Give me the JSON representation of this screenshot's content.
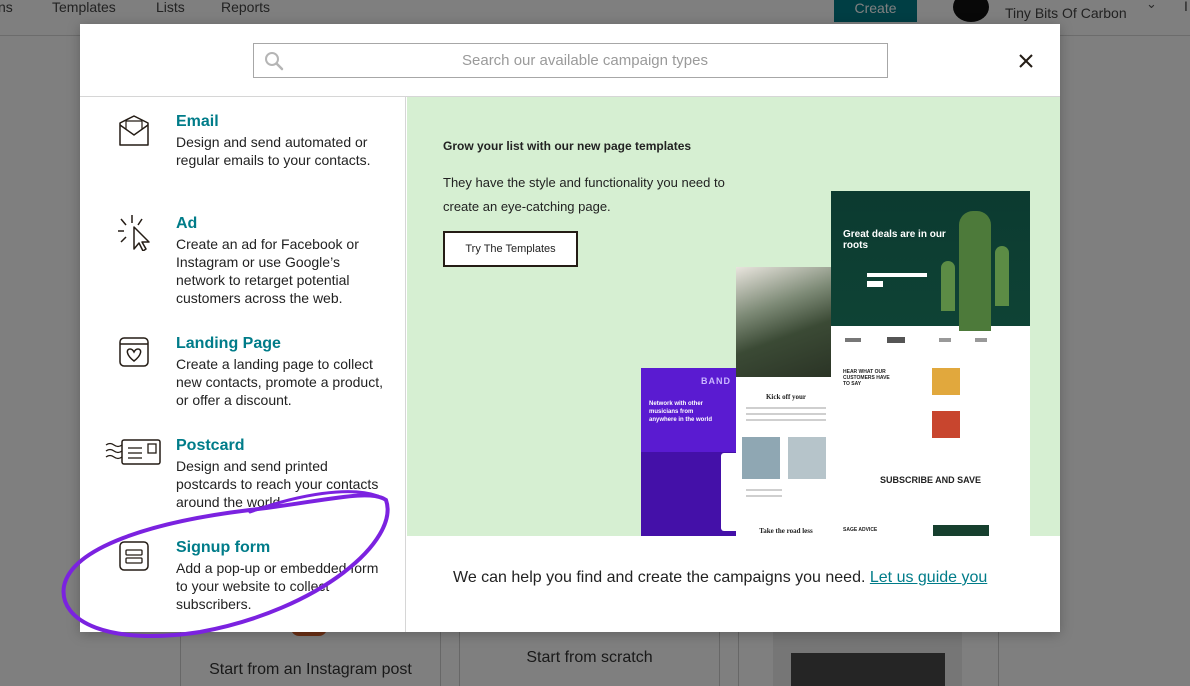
{
  "nav": {
    "items": [
      "ns",
      "Templates",
      "Lists",
      "Reports"
    ],
    "create_label": "Create",
    "account_name": "Tiny Bits Of Carbon",
    "edge_text": "I"
  },
  "background_cards": [
    {
      "label": "Start from an Instagram post"
    },
    {
      "label": "Start from scratch"
    }
  ],
  "modal": {
    "search": {
      "placeholder": "Search our available campaign types"
    },
    "types": [
      {
        "icon": "envelope-icon",
        "title": "Email",
        "description": "Design and send automated or regular emails to your contacts."
      },
      {
        "icon": "cursor-click-icon",
        "title": "Ad",
        "description": "Create an ad for Facebook or Instagram or use Google’s network to retarget potential customers across the web."
      },
      {
        "icon": "heart-page-icon",
        "title": "Landing Page",
        "description": "Create a landing page to collect new contacts, promote a product, or offer a discount."
      },
      {
        "icon": "postcard-icon",
        "title": "Postcard",
        "description": "Design and send printed postcards to reach your contacts around the world."
      },
      {
        "icon": "form-icon",
        "title": "Signup form",
        "description": "Add a pop-up or embedded form to your website to collect subscribers."
      }
    ],
    "promo": {
      "title": "Grow your list with our new page templates",
      "description": "They have the style and functionality you need to create an eye-catching page.",
      "button_label": "Try The Templates",
      "mockups": {
        "purple_brand": "BAND",
        "purple_text": "Network with other musicians from anywhere in the world",
        "mid_heading": "Kick off your",
        "mid_heading2": "Take the road less",
        "big_hero_title": "Great deals are in our roots",
        "big_quote_heading": "HEAR WHAT OUR CUSTOMERS HAVE TO SAY",
        "big_subscribe": "SUBSCRIBE AND SAVE",
        "big_advice": "SAGE ADVICE"
      }
    },
    "footer": {
      "text": "We can help you find and create the campaigns you need.",
      "link_label": "Let us guide you"
    }
  },
  "colors": {
    "brand": "#007c89",
    "promo_bg": "#d6efd2",
    "annotation": "#7b22e0"
  }
}
